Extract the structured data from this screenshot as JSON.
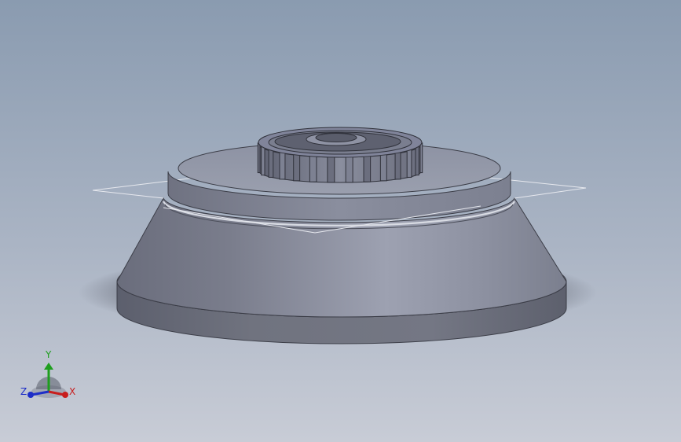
{
  "viewport": {
    "background_top": "#8a9bb0",
    "background_bottom": "#c8ccd6"
  },
  "model": {
    "body_color": "#8a8e9e",
    "body_shadow": "#4a4d5a",
    "edge_color": "#3a3c46"
  },
  "reference_plane": {
    "color": "#e8e8ee"
  },
  "triad": {
    "x_label": "X",
    "y_label": "Y",
    "z_label": "Z",
    "x_color": "#c81e1e",
    "y_color": "#1e9e1e",
    "z_color": "#1e2ec8"
  }
}
